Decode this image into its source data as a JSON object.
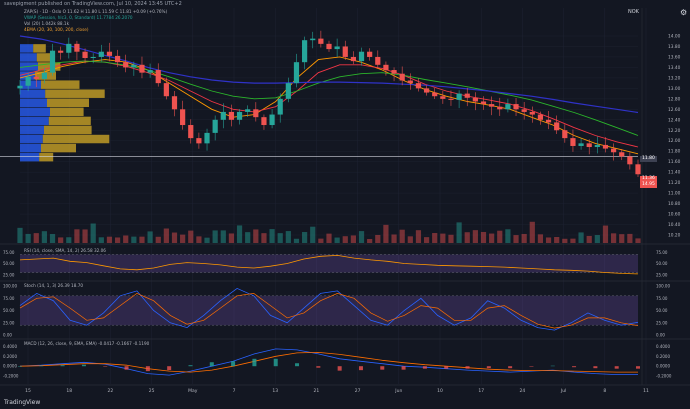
{
  "header": {
    "published": "savepigment published on TradingView.com, Jul 10, 2024 13:45 UTC+2",
    "symbol": "NOK"
  },
  "indicator_legends": {
    "price": "ZAP(S) · 1D · Oslo  O 11.62  H 11.80  L 11.59  C 11.81  +0.09 (+0.76%)",
    "vwap": "VWAP (Session, hlc3, 0, Standard)  11.7784  26.2070",
    "vol": "Vol (20)  1.042k  88.1k",
    "ma": "4EMA (20, 30, 100, 200, close)",
    "rsi": "RSI (14, close, SMA, 14, 2)  26.58  32.06",
    "stoch": "Stoch (14, 1, 3)  26.39  18.70",
    "macd": "MACD (12, 26, close, 9, EMA, EMA)  -0.0417  -0.1667  -0.1190"
  },
  "price_labels": {
    "last": "11.80",
    "current": "11.36",
    "current_sub": "14.95"
  },
  "logo": "TradingView",
  "colors": {
    "background": "#131722",
    "grid": "#1f2433",
    "up": "#26a69a",
    "down": "#ef5350",
    "ma_orange": "#ff9800",
    "ma_red": "#f23645",
    "ma_green": "#2bb52b",
    "ma_blue": "#2f32c8",
    "vp_blue": "#2962ff",
    "vp_gold": "#c9a227",
    "rsi_band": "#7e57c2",
    "stoch_line": "#2962ff",
    "stoch_signal": "#ff6d00",
    "panel_line": "#b2b5be"
  },
  "chart_data": {
    "type": "candlestick",
    "price_axis": {
      "ticks": [
        "14.00",
        "13.80",
        "13.60",
        "13.40",
        "13.20",
        "13.00",
        "12.80",
        "12.60",
        "12.40",
        "12.20",
        "12.00",
        "11.80",
        "11.60",
        "11.40",
        "11.20",
        "11.00",
        "10.80",
        "10.60",
        "10.40",
        "10.20"
      ],
      "ylim": [
        10.2,
        14.0
      ]
    },
    "x_labels": [
      "15",
      "18",
      "22",
      "25",
      "May",
      "7",
      "13",
      "21",
      "27",
      "Jun",
      "10",
      "17",
      "24",
      "Jul",
      "8",
      "11"
    ],
    "horizontal_line": 11.7,
    "close_series": [
      13.05,
      13.22,
      13.18,
      13.3,
      13.72,
      13.68,
      13.85,
      13.7,
      13.58,
      13.6,
      13.7,
      13.62,
      13.5,
      13.4,
      13.45,
      13.3,
      13.35,
      13.1,
      12.85,
      12.6,
      12.3,
      12.05,
      11.95,
      12.15,
      12.4,
      12.55,
      12.4,
      12.55,
      12.6,
      12.45,
      12.3,
      12.5,
      12.8,
      13.1,
      13.5,
      13.92,
      13.95,
      13.85,
      13.75,
      13.8,
      13.6,
      13.52,
      13.7,
      13.6,
      13.45,
      13.35,
      13.28,
      13.15,
      13.1,
      13.0,
      12.92,
      12.85,
      12.8,
      12.78,
      12.9,
      12.82,
      12.75,
      12.7,
      12.65,
      12.6,
      12.7,
      12.6,
      12.55,
      12.5,
      12.4,
      12.35,
      12.2,
      12.05,
      11.9,
      11.95,
      11.88,
      11.92,
      11.85,
      11.78,
      11.7,
      11.55,
      11.36
    ],
    "moving_averages": [
      {
        "values": [
          13.2,
          13.3,
          13.42,
          13.5,
          13.55,
          13.5,
          13.35,
          13.1,
          12.85,
          12.6,
          12.45,
          12.5,
          12.75,
          13.2,
          13.55,
          13.6,
          13.5,
          13.35,
          13.15,
          12.98,
          12.85,
          12.75,
          12.68,
          12.6,
          12.45,
          12.3,
          12.1,
          11.95,
          11.85,
          11.75
        ]
      },
      {
        "values": [
          13.25,
          13.35,
          13.45,
          13.52,
          13.5,
          13.42,
          13.3,
          13.15,
          12.95,
          12.75,
          12.6,
          12.55,
          12.65,
          12.95,
          13.3,
          13.45,
          13.45,
          13.38,
          13.25,
          13.08,
          12.95,
          12.85,
          12.78,
          12.7,
          12.58,
          12.42,
          12.25,
          12.1,
          11.98,
          11.88
        ]
      },
      {
        "values": [
          13.4,
          13.45,
          13.5,
          13.52,
          13.5,
          13.44,
          13.35,
          13.22,
          13.08,
          12.95,
          12.85,
          12.8,
          12.82,
          12.95,
          13.1,
          13.22,
          13.28,
          13.3,
          13.25,
          13.17,
          13.1,
          13.03,
          12.95,
          12.87,
          12.78,
          12.66,
          12.54,
          12.4,
          12.25,
          12.1
        ]
      },
      {
        "values": [
          14.0,
          13.94,
          13.85,
          13.74,
          13.63,
          13.52,
          13.4,
          13.3,
          13.22,
          13.16,
          13.12,
          13.1,
          13.1,
          13.11,
          13.12,
          13.12,
          13.11,
          13.1,
          13.08,
          13.06,
          13.03,
          12.99,
          12.95,
          12.9,
          12.85,
          12.79,
          12.72,
          12.66,
          12.6,
          12.54
        ]
      }
    ],
    "volume_profile": {
      "blue": [
        0.22,
        0.28,
        0.3,
        0.25,
        0.35,
        0.42,
        0.45,
        0.5,
        0.48,
        0.4,
        0.38,
        0.35,
        0.32
      ],
      "gold": [
        0.18,
        0.25,
        0.32,
        0.3,
        0.55,
        0.85,
        0.6,
        0.48,
        0.6,
        0.68,
        0.95,
        0.5,
        0.2
      ]
    },
    "rsi": {
      "axis": [
        "75.00",
        "50.00",
        "25.00"
      ],
      "ylim": [
        20,
        80
      ],
      "band": [
        30,
        70
      ],
      "values": [
        58,
        60,
        62,
        55,
        52,
        45,
        38,
        36,
        40,
        48,
        52,
        50,
        47,
        42,
        40,
        44,
        50,
        60,
        66,
        68,
        62,
        58,
        55,
        50,
        48,
        46,
        45,
        44,
        43,
        42,
        40,
        38,
        36,
        35,
        33,
        30,
        28,
        27
      ]
    },
    "stoch": {
      "axis": [
        "100.00",
        "75.00",
        "50.00",
        "25.00",
        "0.00"
      ],
      "ylim": [
        0,
        100
      ],
      "band": [
        20,
        80
      ],
      "k": [
        60,
        85,
        70,
        30,
        20,
        45,
        80,
        90,
        50,
        25,
        15,
        40,
        70,
        95,
        80,
        40,
        25,
        55,
        85,
        90,
        60,
        30,
        20,
        50,
        75,
        40,
        20,
        35,
        70,
        55,
        30,
        15,
        10,
        25,
        45,
        30,
        20,
        26
      ],
      "d": [
        55,
        75,
        78,
        55,
        30,
        35,
        60,
        85,
        70,
        40,
        22,
        30,
        55,
        80,
        85,
        60,
        35,
        45,
        70,
        85,
        75,
        45,
        28,
        40,
        60,
        55,
        30,
        30,
        55,
        60,
        40,
        22,
        14,
        20,
        35,
        35,
        25,
        19
      ]
    },
    "macd": {
      "axis": [
        "0.4000",
        "0.2000",
        "0.0000",
        "-0.2000"
      ],
      "ylim": [
        -0.3,
        0.45
      ],
      "macd": [
        0.0,
        0.02,
        0.05,
        0.08,
        0.04,
        -0.05,
        -0.15,
        -0.18,
        -0.1,
        0.0,
        0.1,
        0.25,
        0.35,
        0.33,
        0.25,
        0.15,
        0.1,
        0.05,
        0.0,
        -0.02,
        -0.05,
        -0.08,
        -0.1,
        -0.12,
        -0.1,
        -0.08,
        -0.12,
        -0.15,
        -0.17,
        -0.17
      ],
      "signal": [
        0.0,
        0.01,
        0.03,
        0.05,
        0.05,
        0.02,
        -0.05,
        -0.1,
        -0.12,
        -0.08,
        0.0,
        0.1,
        0.2,
        0.27,
        0.28,
        0.24,
        0.18,
        0.12,
        0.07,
        0.03,
        0.0,
        -0.03,
        -0.06,
        -0.08,
        -0.09,
        -0.09,
        -0.1,
        -0.11,
        -0.12,
        -0.12
      ]
    }
  }
}
